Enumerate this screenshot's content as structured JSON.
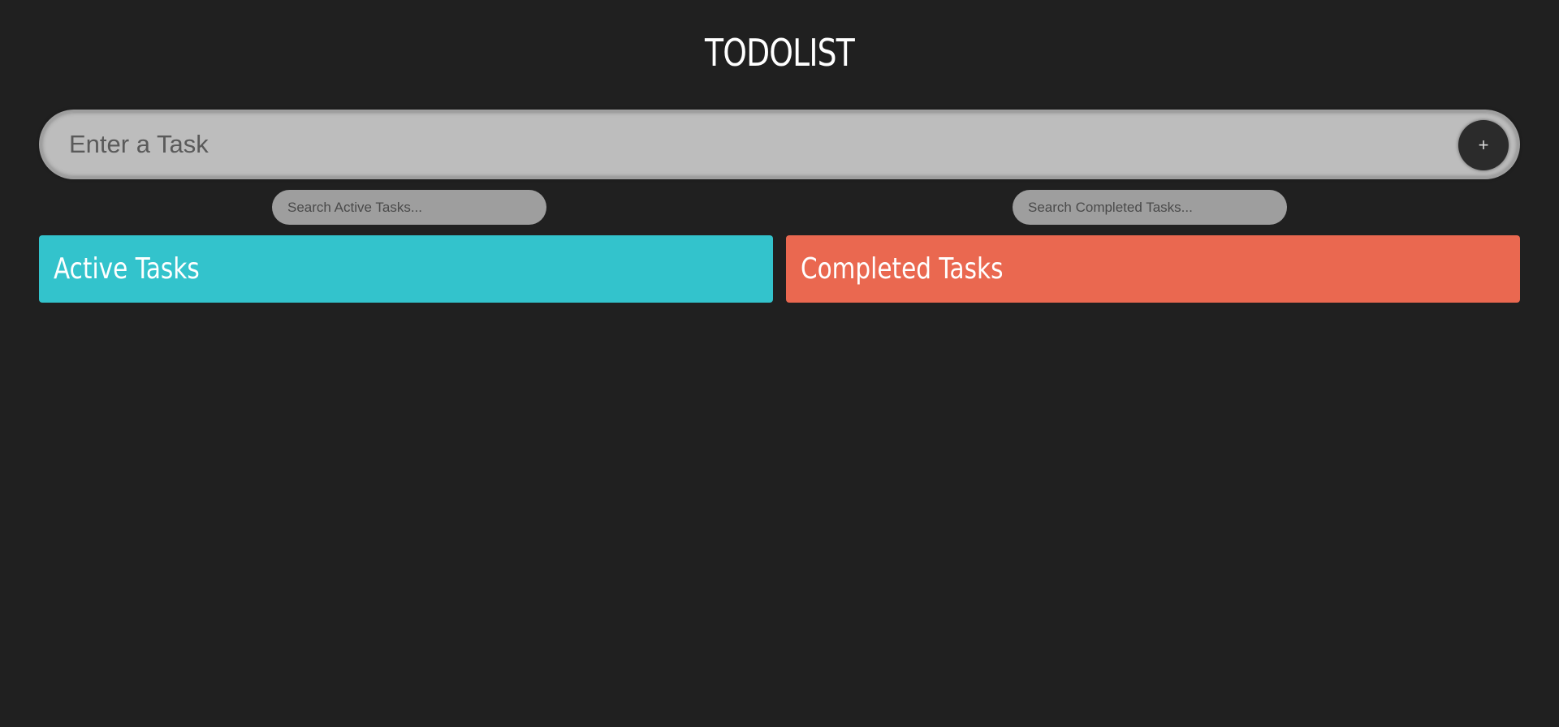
{
  "app": {
    "title": "TODOLIST"
  },
  "task_input": {
    "placeholder": "Enter a Task",
    "value": ""
  },
  "add_button": {
    "label": "+"
  },
  "search_active": {
    "placeholder": "Search Active Tasks...",
    "value": ""
  },
  "search_completed": {
    "placeholder": "Search Completed Tasks...",
    "value": ""
  },
  "panels": {
    "active": {
      "title": "Active Tasks",
      "color": "#33c3cc",
      "items": []
    },
    "completed": {
      "title": "Completed Tasks",
      "color": "#ea6850",
      "items": []
    }
  },
  "theme": {
    "background": "#202020",
    "input_background": "#bdbdbd",
    "button_background": "#2b2b2b"
  }
}
